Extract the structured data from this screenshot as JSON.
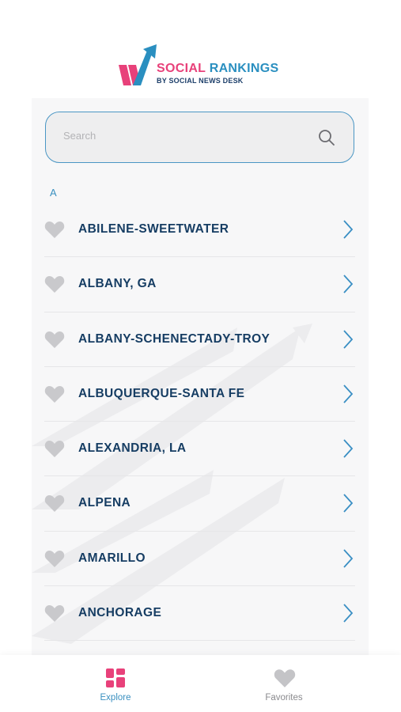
{
  "header": {
    "logo_title_part1": "SOCIAL",
    "logo_title_part2": "RANKINGS",
    "logo_subtitle": "BY SOCIAL NEWS DESK"
  },
  "search": {
    "placeholder": "Search",
    "icon": "search-icon"
  },
  "section_letter": "A",
  "markets": [
    {
      "label": "ABILENE-SWEETWATER",
      "favorited": false
    },
    {
      "label": "ALBANY, GA",
      "favorited": false
    },
    {
      "label": "ALBANY-SCHENECTADY-TROY",
      "favorited": false
    },
    {
      "label": "ALBUQUERQUE-SANTA FE",
      "favorited": false
    },
    {
      "label": "ALEXANDRIA, LA",
      "favorited": false
    },
    {
      "label": "ALPENA",
      "favorited": false
    },
    {
      "label": "AMARILLO",
      "favorited": false
    },
    {
      "label": "ANCHORAGE",
      "favorited": false
    }
  ],
  "tabs": {
    "explore": {
      "label": "Explore",
      "icon": "grid-icon",
      "active": true
    },
    "favorites": {
      "label": "Favorites",
      "icon": "heart-icon",
      "active": false
    }
  },
  "colors": {
    "brand_pink": "#e8417a",
    "brand_blue": "#2a8fc0",
    "text_navy": "#163d63",
    "heart_gray": "#c9c9cc",
    "chevron_blue": "#3a8fc4"
  }
}
